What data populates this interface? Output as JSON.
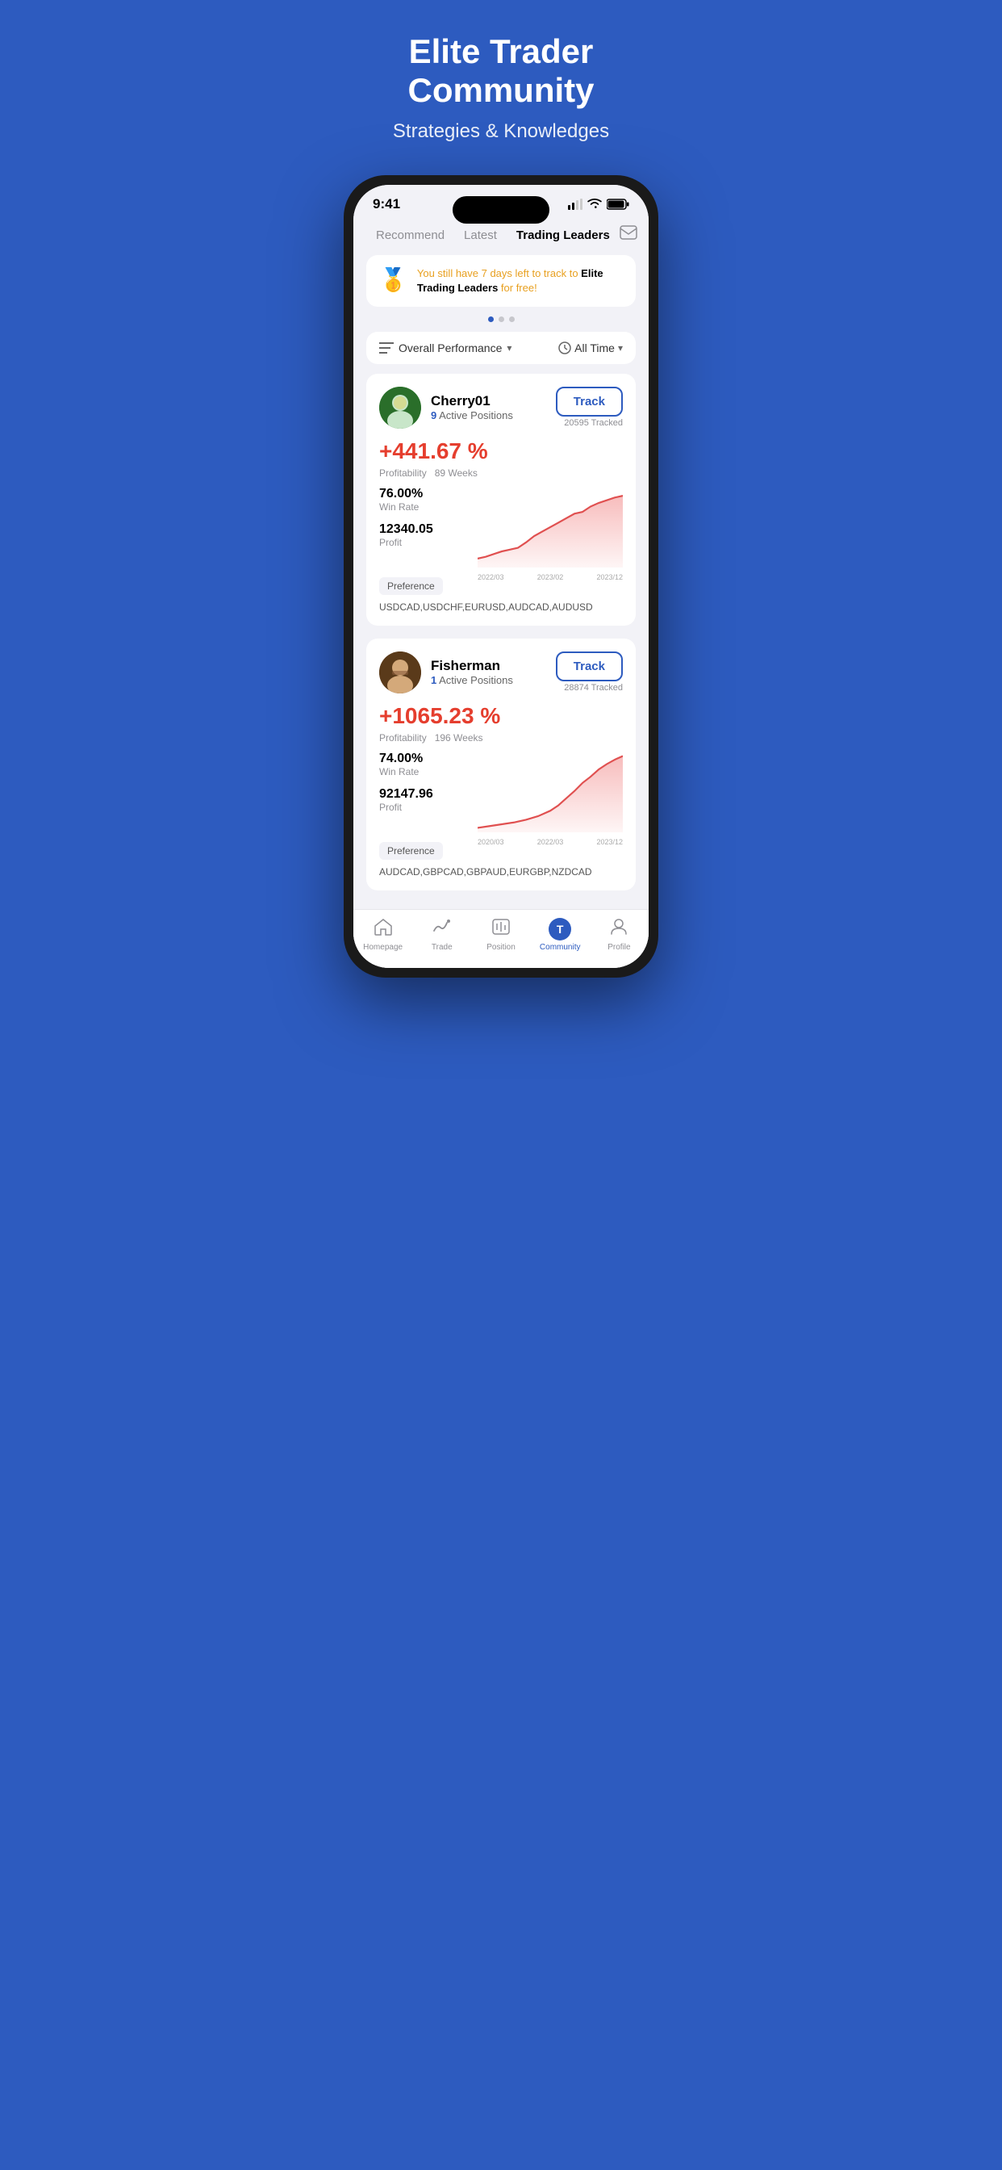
{
  "hero": {
    "title": "Elite Trader\nCommunity",
    "subtitle": "Strategies & Knowledges"
  },
  "status_bar": {
    "time": "9:41",
    "signal": "▂▃▅",
    "wifi": "wifi",
    "battery": "battery"
  },
  "nav_tabs": [
    {
      "label": "Recommend",
      "active": false
    },
    {
      "label": "Latest",
      "active": false
    },
    {
      "label": "Trading Leaders",
      "active": true
    }
  ],
  "banner": {
    "icon": "🥇",
    "text_highlight": "You still have 7 days left to track to",
    "text_bold": " Elite Trading Leaders",
    "text_end": " for free!"
  },
  "filter": {
    "performance_label": "Overall Performance",
    "time_label": "All Time"
  },
  "traders": [
    {
      "name": "Cherry01",
      "active_positions_count": "9",
      "active_positions_label": "Active Positions",
      "track_label": "Track",
      "tracked_count": "20595 Tracked",
      "profit_pct": "+441.67 %",
      "profitability_weeks": "Profitability  89 Weeks",
      "win_rate_value": "76.00%",
      "win_rate_label": "Win Rate",
      "profit_value": "12340.05",
      "profit_label": "Profit",
      "chart_dates": [
        "2022/03",
        "2023/02",
        "2023/12"
      ],
      "preference_label": "Preference",
      "preference_pairs": "USDCAD,USDCHF,EURUSD,AUDCAD,AUDUSD",
      "avatar_letter": "🧑"
    },
    {
      "name": "Fisherman",
      "active_positions_count": "1",
      "active_positions_label": "Active Positions",
      "track_label": "Track",
      "tracked_count": "28874 Tracked",
      "profit_pct": "+1065.23 %",
      "profitability_weeks": "Profitability  196 Weeks",
      "win_rate_value": "74.00%",
      "win_rate_label": "Win Rate",
      "profit_value": "92147.96",
      "profit_label": "Profit",
      "chart_dates": [
        "2020/03",
        "2022/03",
        "2023/12"
      ],
      "preference_label": "Preference",
      "preference_pairs": "AUDCAD,GBPCAD,GBPAUD,EURGBP,NZDCAD",
      "avatar_letter": "🧔"
    }
  ],
  "bottom_nav": [
    {
      "label": "Homepage",
      "icon": "⌂",
      "active": false
    },
    {
      "label": "Trade",
      "icon": "〜",
      "active": false
    },
    {
      "label": "Position",
      "icon": "▣",
      "active": false
    },
    {
      "label": "Community",
      "icon": "T",
      "active": true
    },
    {
      "label": "Profile",
      "icon": "◎",
      "active": false
    }
  ]
}
